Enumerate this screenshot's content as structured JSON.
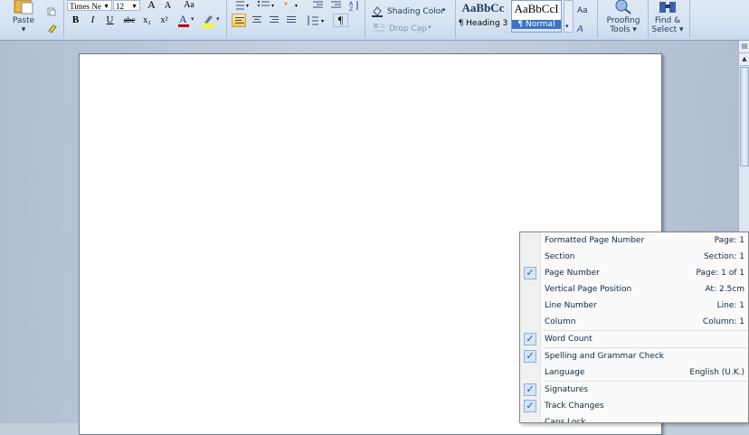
{
  "ribbon": {
    "paste_label": "Paste",
    "font_name": "Times Ne",
    "font_size": "12",
    "bold": "B",
    "italic": "I",
    "underline": "U",
    "strikethrough": "abc",
    "subscript": "x₂",
    "superscript": "x²",
    "grow_font": "A",
    "shrink_font": "A",
    "change_case": "Aa",
    "font_color_glyph": "A",
    "pilcrow": "¶",
    "shading_color_label": "Shading Color",
    "drop_cap_label": "Drop Cap",
    "styles": [
      {
        "sample": "AaBbCc",
        "name": "¶ Heading 3"
      },
      {
        "sample": "AaBbCcI",
        "name": "¶ Normal"
      }
    ],
    "proofing_line1": "Proofing",
    "proofing_line2": "Tools",
    "find_line1": "Find &",
    "find_line2": "Select"
  },
  "status_menu": {
    "items": [
      {
        "label": "Formatted Page Number",
        "value": "Page: 1",
        "checked": false
      },
      {
        "label": "Section",
        "value": "Section: 1",
        "checked": false
      },
      {
        "label": "Page Number",
        "value": "Page: 1 of 1",
        "checked": true
      },
      {
        "label": "Vertical Page Position",
        "value": "At: 2.5cm",
        "checked": false
      },
      {
        "label": "Line Number",
        "value": "Line: 1",
        "checked": false
      },
      {
        "label": "Column",
        "value": "Column: 1",
        "checked": false
      },
      {
        "label": "Word Count",
        "value": "",
        "checked": true
      },
      {
        "label": "Spelling and Grammar Check",
        "value": "",
        "checked": true
      },
      {
        "label": "Language",
        "value": "English (U.K.)",
        "checked": false
      },
      {
        "label": "Signatures",
        "value": "",
        "checked": true
      },
      {
        "label": "Track Changes",
        "value": "",
        "checked": true
      },
      {
        "label": "Caps Lock",
        "value": "",
        "checked": false
      }
    ]
  },
  "colors": {
    "ribbon_bg": "#dfe9f5",
    "highlight_yellow": "#ffff00",
    "font_color_red": "#c00000",
    "check_blue": "#1e5aa8"
  }
}
